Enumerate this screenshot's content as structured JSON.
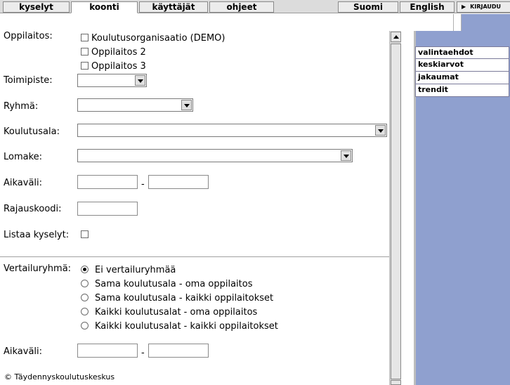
{
  "nav": {
    "tabs": [
      {
        "label": "kyselyt"
      },
      {
        "label": "koonti"
      },
      {
        "label": "käyttäjät"
      },
      {
        "label": "ohjeet"
      }
    ],
    "lang_fi": "Suomi",
    "lang_en": "English",
    "login": "KIRJAUDU"
  },
  "form": {
    "oppilaitos_label": "Oppilaitos:",
    "oppilaitos_options": [
      "Koulutusorganisaatio (DEMO)",
      "Oppilaitos 2",
      "Oppilaitos 3"
    ],
    "toimipiste_label": "Toimipiste:",
    "ryhma_label": "Ryhmä:",
    "koulutusala_label": "Koulutusala:",
    "lomake_label": "Lomake:",
    "aikavali_label": "Aikaväli:",
    "rajauskoodi_label": "Rajauskoodi:",
    "listaa_label": "Listaa kyselyt:",
    "vertailu_label": "Vertailuryhmä:",
    "vertailu_options": [
      "Ei vertailuryhmää",
      "Sama koulutusala - oma oppilaitos",
      "Sama koulutusala - kaikki oppilaitokset",
      "Kaikki koulutusalat - oma oppilaitos",
      "Kaikki koulutusalat - kaikki oppilaitokset"
    ],
    "vertailu_selected": 0,
    "aikavali2_label": "Aikaväli:",
    "dash": "-"
  },
  "side_menu": [
    "valintaehdot",
    "keskiarvot",
    "jakaumat",
    "trendit"
  ],
  "footer": "© Täydennyskoulutuskeskus"
}
